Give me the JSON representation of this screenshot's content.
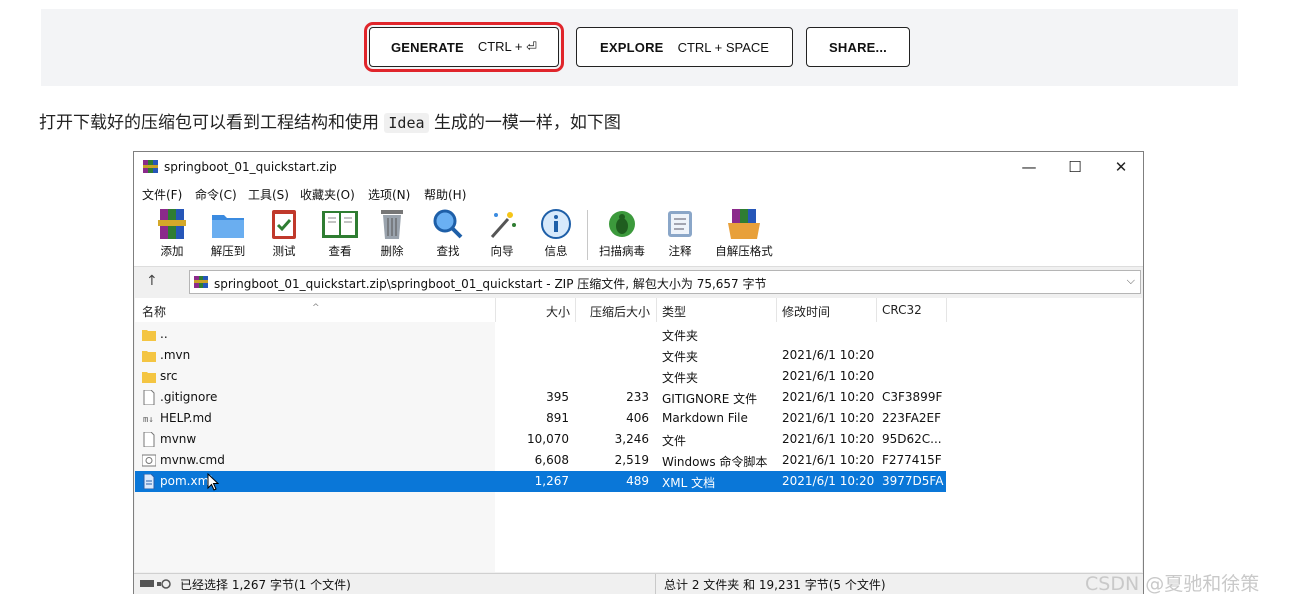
{
  "top_buttons": {
    "generate": {
      "label": "GENERATE",
      "shortcut": "CTRL + ⏎"
    },
    "explore": {
      "label": "EXPLORE",
      "shortcut": "CTRL + SPACE"
    },
    "share": {
      "label": "SHARE..."
    }
  },
  "paragraph": {
    "before": "打开下载好的压缩包可以看到工程结构和使用",
    "code": "Idea",
    "after": "生成的一模一样，如下图"
  },
  "window": {
    "title": "springboot_01_quickstart.zip",
    "controls": {
      "minimize": "—",
      "maximize": "☐",
      "close": "✕"
    },
    "menu": [
      "文件(F)",
      "命令(C)",
      "工具(S)",
      "收藏夹(O)",
      "选项(N)",
      "帮助(H)"
    ],
    "toolbar": [
      "添加",
      "解压到",
      "测试",
      "查看",
      "删除",
      "查找",
      "向导",
      "信息",
      "扫描病毒",
      "注释",
      "自解压格式"
    ],
    "address": "springboot_01_quickstart.zip\\springboot_01_quickstart - ZIP 压缩文件, 解包大小为 75,657 字节",
    "columns": {
      "name": "名称",
      "size": "大小",
      "packed": "压缩后大小",
      "type": "类型",
      "modified": "修改时间",
      "crc": "CRC32"
    },
    "files": [
      {
        "name": "..",
        "size": "",
        "packed": "",
        "type": "文件夹",
        "modified": "",
        "crc": "",
        "icon": "folder-icon"
      },
      {
        "name": ".mvn",
        "size": "",
        "packed": "",
        "type": "文件夹",
        "modified": "2021/6/1 10:20",
        "crc": "",
        "icon": "folder-icon"
      },
      {
        "name": "src",
        "size": "",
        "packed": "",
        "type": "文件夹",
        "modified": "2021/6/1 10:20",
        "crc": "",
        "icon": "folder-icon"
      },
      {
        "name": ".gitignore",
        "size": "395",
        "packed": "233",
        "type": "GITIGNORE 文件",
        "modified": "2021/6/1 10:20",
        "crc": "C3F3899F",
        "icon": "file-icon"
      },
      {
        "name": "HELP.md",
        "size": "891",
        "packed": "406",
        "type": "Markdown File",
        "modified": "2021/6/1 10:20",
        "crc": "223FA2EF",
        "icon": "markdown-icon"
      },
      {
        "name": "mvnw",
        "size": "10,070",
        "packed": "3,246",
        "type": "文件",
        "modified": "2021/6/1 10:20",
        "crc": "95D62C...",
        "icon": "file-icon"
      },
      {
        "name": "mvnw.cmd",
        "size": "6,608",
        "packed": "2,519",
        "type": "Windows 命令脚本",
        "modified": "2021/6/1 10:20",
        "crc": "F277415F",
        "icon": "cmd-icon"
      },
      {
        "name": "pom.xml",
        "size": "1,267",
        "packed": "489",
        "type": "XML 文档",
        "modified": "2021/6/1 10:20",
        "crc": "3977D5FA",
        "icon": "xml-icon",
        "selected": true
      }
    ],
    "status_left": "已经选择 1,267 字节(1 个文件)",
    "status_right": "总计 2 文件夹 和 19,231 字节(5 个文件)"
  },
  "watermark": "CSDN @夏驰和徐策",
  "colors": {
    "highlight_border": "#e0252b",
    "selection": "#0a77d8",
    "folder": "#f4c542"
  }
}
